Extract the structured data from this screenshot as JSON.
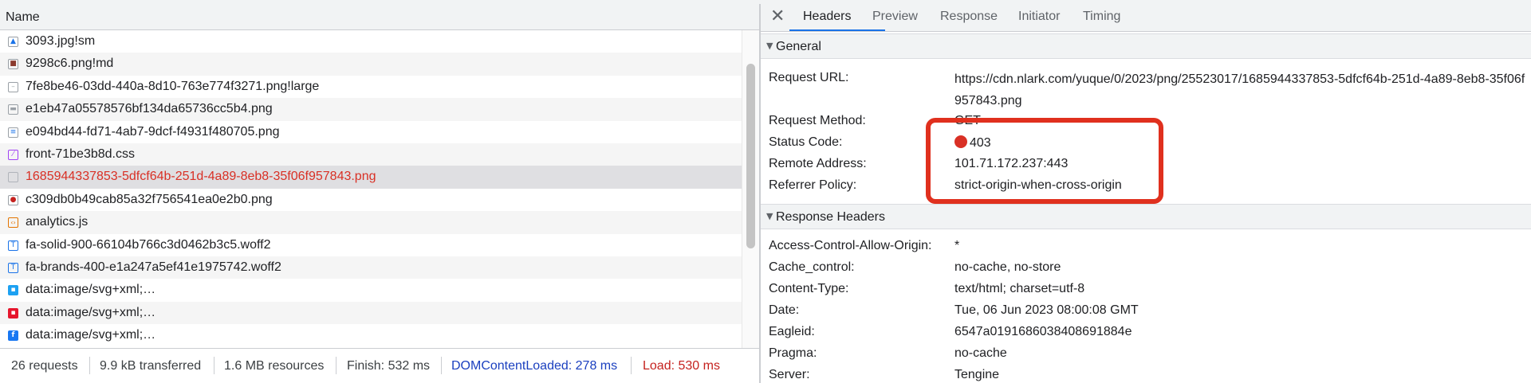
{
  "network": {
    "column_header": "Name",
    "rows": [
      {
        "name": "3093.jpg!sm",
        "icon": "image-icon",
        "glyph": "▲"
      },
      {
        "name": "9298c6.png!md",
        "icon": "image-icon",
        "glyph": "■"
      },
      {
        "name": "7fe8be46-03dd-440a-8d10-763e774f3271.png!large",
        "icon": "image-icon",
        "glyph": "–"
      },
      {
        "name": "e1eb47a05578576bf134da65736cc5b4.png",
        "icon": "image-icon",
        "glyph": "▬"
      },
      {
        "name": "e094bd44-fd71-4ab7-9dcf-f4931f480705.png",
        "icon": "image-icon",
        "glyph": "≡"
      },
      {
        "name": "front-71be3b8d.css",
        "icon": "stylesheet-icon",
        "glyph": "⁄"
      },
      {
        "name": "1685944337853-5dfcf64b-251d-4a89-8eb8-35f06f957843.png",
        "icon": "image-icon",
        "glyph": ""
      },
      {
        "name": "c309db0b49cab85a32f756541ea0e2b0.png",
        "icon": "image-icon",
        "glyph": "●"
      },
      {
        "name": "analytics.js",
        "icon": "script-icon",
        "glyph": "‹›"
      },
      {
        "name": "fa-solid-900-66104b766c3d0462b3c5.woff2",
        "icon": "font-icon",
        "glyph": "T"
      },
      {
        "name": "fa-brands-400-e1a247a5ef41e1975742.woff2",
        "icon": "font-icon",
        "glyph": "T"
      },
      {
        "name": "data:image/svg+xml;…",
        "icon": "twitter-icon",
        "glyph": "▪"
      },
      {
        "name": "data:image/svg+xml;…",
        "icon": "weibo-icon",
        "glyph": "▪"
      },
      {
        "name": "data:image/svg+xml;…",
        "icon": "facebook-icon",
        "glyph": "f"
      }
    ],
    "status": {
      "requests": "26 requests",
      "transferred": "9.9 kB transferred",
      "resources": "1.6 MB resources",
      "finish": "Finish: 532 ms",
      "dom_content_loaded": "DOMContentLoaded: 278 ms",
      "load": "Load: 530 ms"
    },
    "colors": {
      "selected_text": "#d93025",
      "dom_loaded": "#1a3fbf",
      "load": "#c5221f"
    }
  },
  "details": {
    "close_glyph": "✕",
    "tabs": [
      "Headers",
      "Preview",
      "Response",
      "Initiator",
      "Timing"
    ],
    "active_tab": "Headers",
    "general": {
      "title": "General",
      "request_url_label": "Request URL:",
      "request_url": "https://cdn.nlark.com/yuque/0/2023/png/25523017/1685944337853-5dfcf64b-251d-4a89-8eb8-35f06f957843.png",
      "request_method_label": "Request Method:",
      "request_method": "GET",
      "status_code_label": "Status Code:",
      "status_code": "403",
      "remote_address_label": "Remote Address:",
      "remote_address": "101.71.172.237:443",
      "referrer_policy_label": "Referrer Policy:",
      "referrer_policy": "strict-origin-when-cross-origin"
    },
    "response_headers": {
      "title": "Response Headers",
      "items": [
        {
          "key": "Access-Control-Allow-Origin:",
          "value": "*"
        },
        {
          "key": "Cache_control:",
          "value": "no-cache, no-store"
        },
        {
          "key": "Content-Type:",
          "value": "text/html; charset=utf-8"
        },
        {
          "key": "Date:",
          "value": "Tue, 06 Jun 2023 08:00:08 GMT"
        },
        {
          "key": "Eagleid:",
          "value": "6547a0191686038408691884e"
        },
        {
          "key": "Pragma:",
          "value": "no-cache"
        },
        {
          "key": "Server:",
          "value": "Tengine"
        }
      ]
    }
  }
}
